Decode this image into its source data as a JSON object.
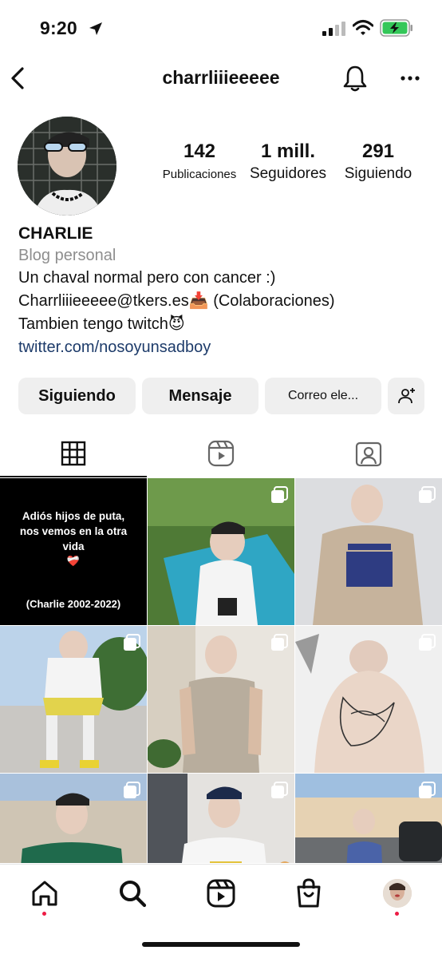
{
  "status_bar": {
    "time": "9:20",
    "icons": [
      "location-arrow-icon",
      "cellular-signal-icon",
      "wifi-icon",
      "battery-charging-icon"
    ],
    "battery_color": "#34c759"
  },
  "nav": {
    "username": "charrliiieeeee",
    "icons": [
      "back-chevron-icon",
      "bell-icon",
      "more-dots-icon"
    ]
  },
  "profile": {
    "stats": [
      {
        "value": "142",
        "label": "Publicaciones"
      },
      {
        "value": "1 mill.",
        "label": "Seguidores"
      },
      {
        "value": "291",
        "label": "Siguiendo"
      }
    ],
    "name": "CHARLIE",
    "category": "Blog personal",
    "bio_line1": "Un chaval normal pero con cancer :)",
    "bio_line2": "Charrliiieeeee@tkers.es",
    "bio_line2_emoji": "📥",
    "bio_line2_suffix": "(Colaboraciones)",
    "bio_line3": "Tambien tengo twitch",
    "bio_line3_emoji": "😈",
    "link": "twitter.com/nosoyunsadboy",
    "link_color": "#1d3b6a"
  },
  "buttons": {
    "following": "Siguiendo",
    "message": "Mensaje",
    "email": "Correo ele...",
    "add_user_icon": "add-person-icon"
  },
  "tabs": [
    {
      "icon": "grid-icon",
      "active": true
    },
    {
      "icon": "reels-icon",
      "active": false
    },
    {
      "icon": "tagged-person-icon",
      "active": false
    }
  ],
  "grid_post_1": {
    "text_line1": "Adiós hijos de puta,",
    "text_line2": "nos vemos en la otra",
    "text_line3": "vida",
    "emoji": "❤️‍🩹",
    "footer": "(Charlie 2002-2022)"
  },
  "bottom_nav": {
    "icons": [
      "home-icon",
      "search-icon",
      "reels-icon",
      "shop-bag-icon",
      "profile-avatar-icon"
    ],
    "notification_dot_color": "#ed1b44"
  }
}
